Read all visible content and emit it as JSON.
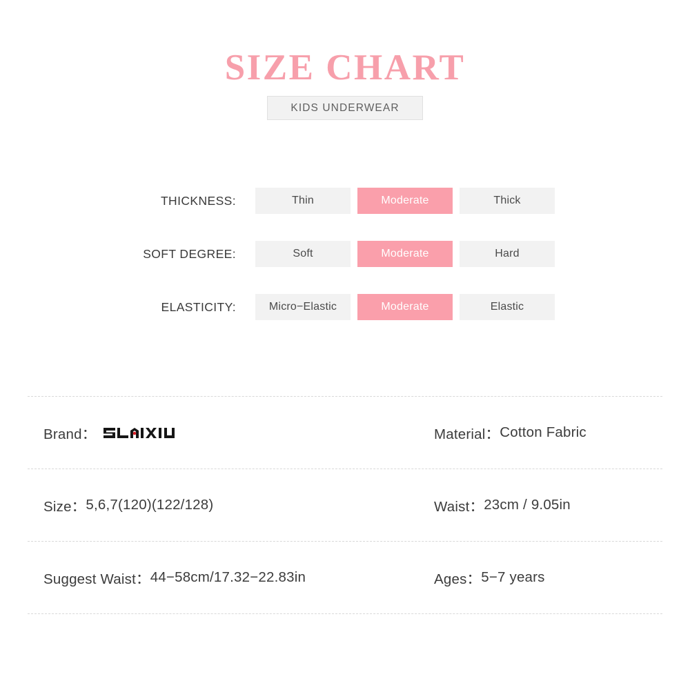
{
  "header": {
    "title": "SIZE CHART",
    "subtitle": "KIDS  UNDERWEAR"
  },
  "attributes": [
    {
      "label": "THICKNESS:",
      "options": [
        {
          "text": "Thin",
          "selected": false
        },
        {
          "text": "Moderate",
          "selected": true
        },
        {
          "text": "Thick",
          "selected": false
        }
      ]
    },
    {
      "label": "SOFT DEGREE:",
      "options": [
        {
          "text": "Soft",
          "selected": false
        },
        {
          "text": "Moderate",
          "selected": true
        },
        {
          "text": "Hard",
          "selected": false
        }
      ]
    },
    {
      "label": "ELASTICITY:",
      "options": [
        {
          "text": "Micro−Elastic",
          "selected": false
        },
        {
          "text": "Moderate",
          "selected": true
        },
        {
          "text": "Elastic",
          "selected": false
        }
      ]
    }
  ],
  "info": {
    "rows": [
      {
        "left": {
          "label": "Brand：",
          "value": "SLAIXIU",
          "is_logo": true
        },
        "right": {
          "label": "Material：",
          "value": "Cotton Fabric"
        }
      },
      {
        "left": {
          "label": "Size：",
          "value": "5,6,7(120)(122/128)"
        },
        "right": {
          "label": "Waist：",
          "value": "23cm / 9.05in"
        }
      },
      {
        "left": {
          "label": "Suggest Waist：",
          "value": "44−58cm/17.32−22.83in"
        },
        "right": {
          "label": "Ages：",
          "value": "5−7 years"
        }
      }
    ]
  },
  "colors": {
    "title_pink": "#f79fab",
    "accent_pink": "#fa9fab",
    "option_bg": "#f2f2f2",
    "text_dark": "#3c3c3c",
    "divider": "#d8d8d8",
    "logo_black": "#161616",
    "logo_dot_red": "#d81f26"
  }
}
